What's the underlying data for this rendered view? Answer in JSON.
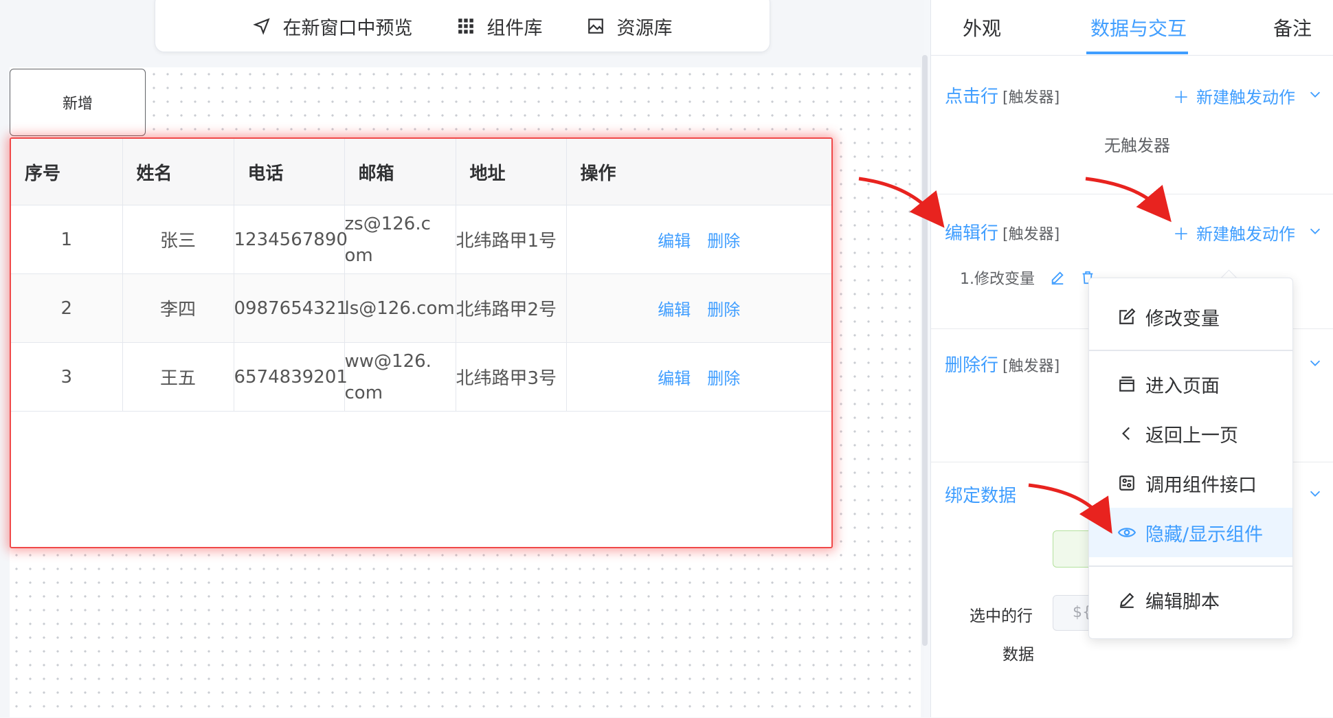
{
  "toolbar": {
    "preview_label": "在新窗口中预览",
    "components_label": "组件库",
    "assets_label": "资源库"
  },
  "canvas": {
    "add_button_label": "新增",
    "table": {
      "headers": [
        "序号",
        "姓名",
        "电话",
        "邮箱",
        "地址",
        "操作"
      ],
      "rows": [
        {
          "index": "1",
          "name": "张三",
          "phone": "1234567890",
          "email": "zs@126.com",
          "address": "北纬路甲1号",
          "edit": "编辑",
          "delete": "删除"
        },
        {
          "index": "2",
          "name": "李四",
          "phone": "0987654321",
          "email": "ls@126.com",
          "address": "北纬路甲2号",
          "edit": "编辑",
          "delete": "删除"
        },
        {
          "index": "3",
          "name": "王五",
          "phone": "6574839201",
          "email": "ww@126.com",
          "address": "北纬路甲3号",
          "edit": "编辑",
          "delete": "删除"
        }
      ]
    }
  },
  "panel": {
    "tabs": [
      {
        "label": "外观",
        "active": false
      },
      {
        "label": "数据与交互",
        "active": true
      },
      {
        "label": "备注",
        "active": false
      }
    ],
    "trigger_tag": "[触发器]",
    "new_action_label": "新建触发动作",
    "sections": {
      "click_row": {
        "title": "点击行",
        "empty_text": "无触发器"
      },
      "edit_row": {
        "title": "编辑行",
        "action_item": "1.修改变量"
      },
      "delete_row": {
        "title": "删除行"
      },
      "bind_data": {
        "title": "绑定数据",
        "selected_row_label_line1": "选中的行",
        "selected_row_label_line2": "数据",
        "input_prefix": "${"
      }
    }
  },
  "dropdown": {
    "items": [
      {
        "label": "修改变量",
        "icon": "edit-square-icon"
      },
      {
        "label": "进入页面",
        "icon": "window-icon"
      },
      {
        "label": "返回上一页",
        "icon": "chevron-left-icon"
      },
      {
        "label": "调用组件接口",
        "icon": "api-icon"
      },
      {
        "label": "隐藏/显示组件",
        "icon": "eye-icon",
        "active": true
      },
      {
        "label": "编辑脚本",
        "icon": "pen-icon"
      }
    ]
  },
  "colors": {
    "accent": "#409eff",
    "selection_border": "#f04848",
    "annotation_arrow": "#e8231f"
  }
}
